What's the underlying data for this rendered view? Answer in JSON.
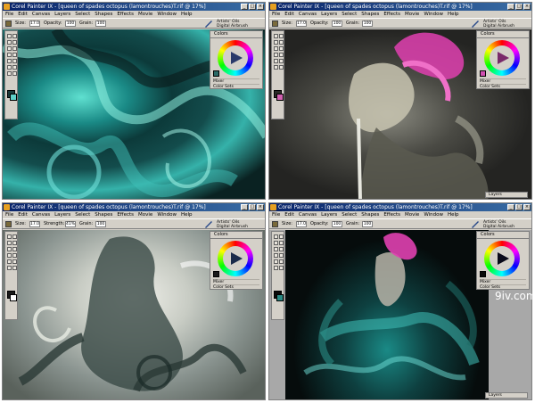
{
  "app": {
    "window_title": "Corel Painter IX - [queen of spades octopus (lamontrouches)T.rif @ 17%]",
    "menus": [
      "File",
      "Edit",
      "Canvas",
      "Layers",
      "Select",
      "Shapes",
      "Effects",
      "Movie",
      "Window",
      "Help"
    ],
    "property_bar": {
      "size_label": "Size:",
      "size_value": "17.0",
      "opacity_label": "Opacity:",
      "opacity_value": "100",
      "strength_label": "Strength:",
      "strength_value": "41%",
      "grain_label": "Grain:",
      "grain_value": "100"
    },
    "brush": {
      "category": "Artists' Oils",
      "variant": "Digital Airbrush"
    },
    "colors_panel": {
      "title": "Colors",
      "rows": [
        "Mixer",
        "Color Sets"
      ]
    },
    "layers_tab": "Layers"
  },
  "watermark": "9iv.com",
  "colors": {
    "titlebar": "#0a246a",
    "chrome": "#d4d0c8",
    "canvas_teal": "#1fa5a0",
    "canvas_dark": "#0c1414",
    "accent_magenta": "#e040b0"
  }
}
